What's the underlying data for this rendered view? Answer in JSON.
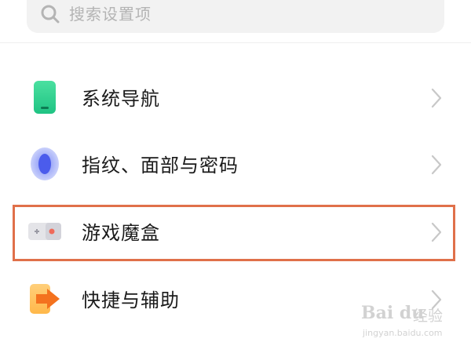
{
  "search": {
    "placeholder": "搜索设置项"
  },
  "settings": {
    "items": [
      {
        "label": "系统导航",
        "icon": "phone-navigation-icon"
      },
      {
        "label": "指纹、面部与密码",
        "icon": "fingerprint-icon"
      },
      {
        "label": "游戏魔盒",
        "icon": "game-box-icon",
        "highlighted": true
      },
      {
        "label": "快捷与辅助",
        "icon": "shortcut-arrow-icon"
      }
    ]
  },
  "colors": {
    "highlight_border": "#e0704a",
    "chevron": "#c8c8c8",
    "search_bg": "#f2f2f2"
  },
  "watermark": {
    "logo": "Bai du",
    "cn": "经验",
    "url": "jingyan.baidu.com"
  }
}
